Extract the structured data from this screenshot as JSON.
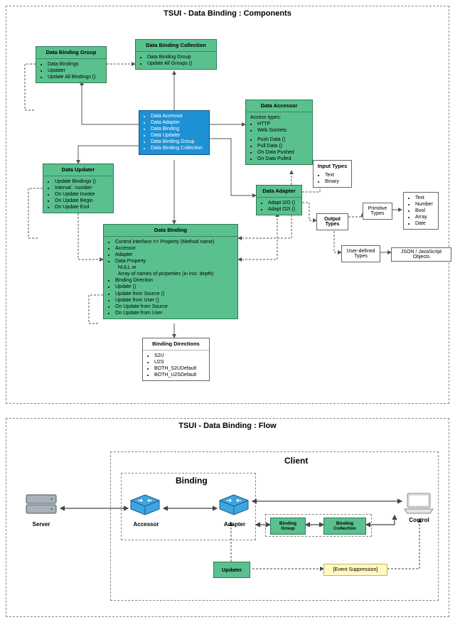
{
  "components": {
    "title": "TSUI - Data Binding : Components",
    "dataBindingGroup": {
      "title": "Data Binding Group",
      "items": [
        "Data Bindings",
        "Updater",
        "Update All Bindings ()"
      ]
    },
    "dataBindingCollection": {
      "title": "Data Binding Collection",
      "items": [
        "Data Binding Group",
        "Update All Groups ()"
      ]
    },
    "central": {
      "items": [
        "Data Accessor",
        "Data Adapter",
        "Data Binding",
        "Data Updater",
        "Data Binding Group",
        "Data Binding Collection"
      ]
    },
    "dataAccessor": {
      "title": "Data Accessor",
      "accessTypesLabel": "Access types:",
      "accessTypes": [
        "HTTP",
        "Web Sockets"
      ],
      "methods": [
        "Push Data ()",
        "Pull Data ()",
        "On Data Pushed",
        "On Data Pulled"
      ]
    },
    "dataUpdater": {
      "title": "Data Updater",
      "items": [
        "Update Bindings ()",
        "Interval : number",
        "On Update Invoke",
        "On Update Begin",
        "On Update End"
      ]
    },
    "dataAdapter": {
      "title": "Data Adapter",
      "items": [
        "Adapt I2O ()",
        "Adapt O2I ()"
      ]
    },
    "inputTypes": {
      "title": "Input Types",
      "items": [
        "Text",
        "Binary"
      ]
    },
    "outputTypes": {
      "title": "Output Types"
    },
    "primitiveTypes": {
      "title": "Primitive Types",
      "items": [
        "Text",
        "Number",
        "Bool",
        "Array",
        "Date"
      ]
    },
    "userDefinedTypes": {
      "title": "User-defined Types"
    },
    "jsonObjects": {
      "label": "JSON / JavaScript Objects"
    },
    "dataBinding": {
      "title": "Data Binding",
      "items": [
        "Control interface => Property (Method name)",
        "Accessor",
        "Adapter",
        "Data Property",
        "NULL or",
        "Array of names of properties (in incr. depth)",
        "Binding Direction",
        "Update ()",
        "Update from Source ()",
        "Update from User ()",
        "On Update from Source",
        "On Update from User"
      ]
    },
    "bindingDirections": {
      "title": "Binding Directions",
      "items": [
        "S2U",
        "U2S",
        "BOTH_S2UDefault",
        "BOTH_U2SDefault"
      ]
    }
  },
  "flow": {
    "title": "TSUI - Data Binding : Flow",
    "clientLabel": "Client",
    "bindingLabel": "Binding",
    "server": "Server",
    "accessor": "Accessor",
    "adapter": "Adapter",
    "control": "Control",
    "bindingGroup": "Binding Group",
    "bindingCollection": "Binding Collection",
    "updater": "Updater",
    "eventSuppression": "[Event Suppression]"
  }
}
